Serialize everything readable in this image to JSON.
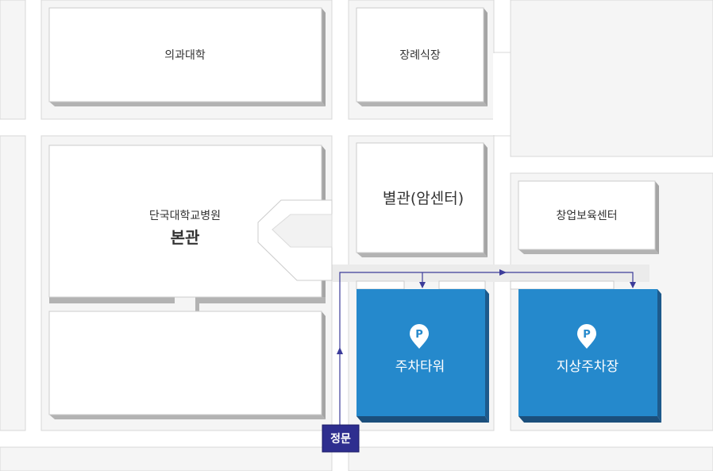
{
  "map": {
    "buildings": {
      "medical_college": "의과대학",
      "funeral_hall": "장례식장",
      "hospital_main_subtitle": "단국대학교병원",
      "hospital_main_title": "본관",
      "annex": "별관(암센터)",
      "childcare_center": "창업보육센터"
    },
    "parking": {
      "parking_tower": "주차타워",
      "ground_parking": "지상주차장",
      "pin_letter": "P"
    },
    "gate": {
      "main_gate": "정문"
    },
    "colors": {
      "parking_fill": "#2589cc",
      "parking_shadow": "#1b4f7c",
      "route_line": "#3c3c9a",
      "gate_fill": "#2e2e8f"
    }
  }
}
